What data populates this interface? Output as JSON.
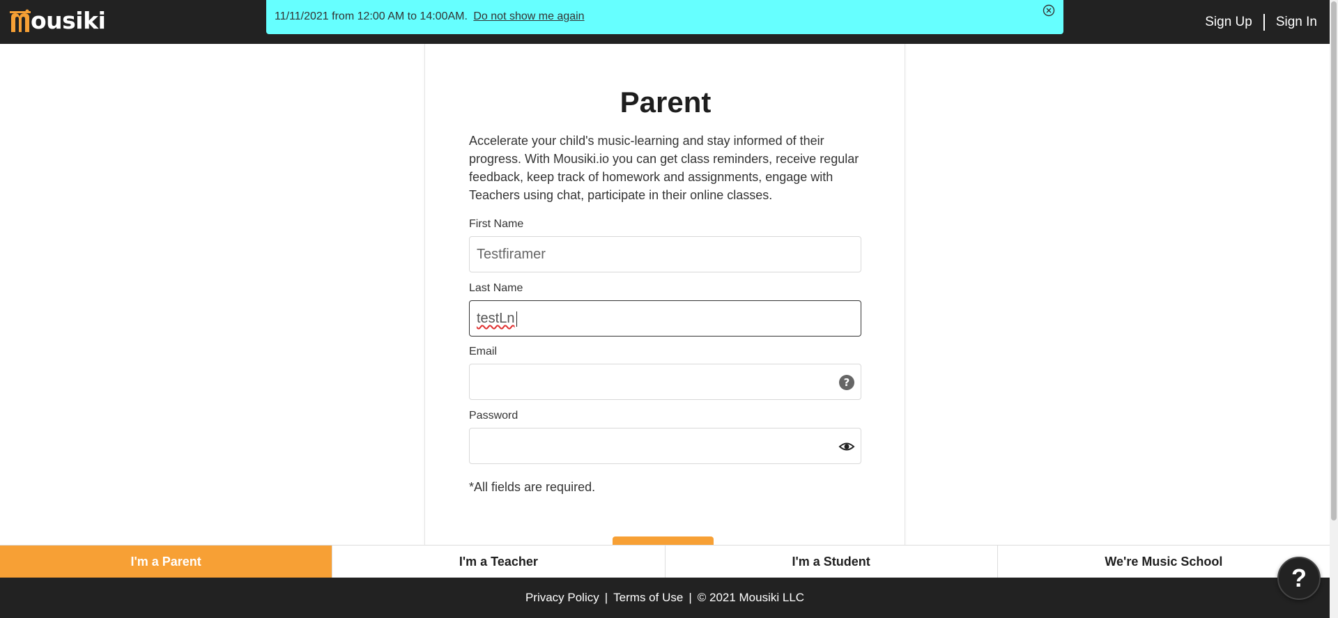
{
  "brand": {
    "logo_text": "ousiki",
    "accent": "#f7a035"
  },
  "nav": {
    "sign_up": "Sign Up",
    "sign_in": "Sign In"
  },
  "banner": {
    "message": "11/11/2021 from 12:00 AM to 14:00AM.",
    "dismiss_link": "Do not show me again",
    "close_icon": "close-circle-icon",
    "color": "#66ffff"
  },
  "form": {
    "title": "Parent",
    "description": "Accelerate your child's music-learning and stay informed of their progress. With Mousiki.io you can get class reminders, receive regular feedback, keep track of homework and assignments, engage with Teachers using chat, participate in their online classes.",
    "first_name": {
      "label": "First Name",
      "value": "Testfiramer"
    },
    "last_name": {
      "label": "Last Name",
      "value": "testLn"
    },
    "email": {
      "label": "Email",
      "value": "",
      "icon": "help-circle-icon"
    },
    "password": {
      "label": "Password",
      "value": "",
      "icon": "eye-icon"
    },
    "required_note": "*All fields are required."
  },
  "roles": [
    {
      "label": "I'm a Parent",
      "active": true
    },
    {
      "label": "I'm a Teacher",
      "active": false
    },
    {
      "label": "I'm a Student",
      "active": false
    },
    {
      "label": "We're Music School",
      "active": false
    }
  ],
  "footer": {
    "privacy": "Privacy Policy",
    "terms": "Terms of Use",
    "copyright": "© 2021 Mousiki LLC",
    "separator": "|"
  },
  "help_button": "?"
}
